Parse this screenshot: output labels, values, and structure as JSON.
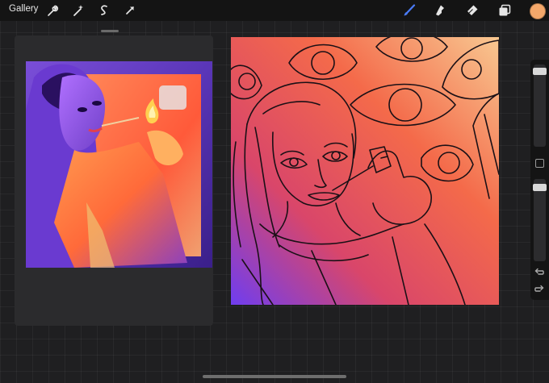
{
  "app": {
    "gallery_label": "Gallery",
    "accent_color": "#4a7bf7",
    "current_color": "#f4a86b"
  },
  "toolbar": {
    "left_tools": [
      "wrench-icon",
      "magic-wand-icon",
      "selection-icon",
      "transform-arrow-icon"
    ],
    "right_tools": [
      "brush-icon",
      "smudge-icon",
      "eraser-icon",
      "layers-icon",
      "color-swatch"
    ],
    "active_tool": "brush-icon"
  },
  "sidebar": {
    "brush_size": 0.94,
    "brush_opacity": 0.86,
    "buttons": [
      "modify-button",
      "undo-icon",
      "redo-icon"
    ]
  },
  "reference_panel": {
    "visible": true
  }
}
